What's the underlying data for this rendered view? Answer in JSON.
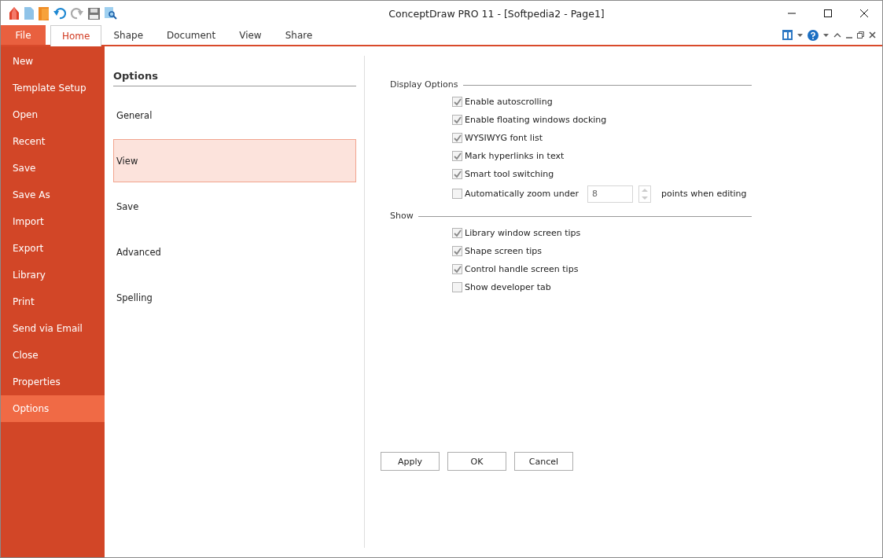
{
  "window": {
    "title": "ConceptDraw PRO 11 - [Softpedia2 - Page1]"
  },
  "ribbon_tabs": [
    {
      "label": "File",
      "kind": "file",
      "selected": false
    },
    {
      "label": "Home",
      "kind": "tab",
      "selected": true
    },
    {
      "label": "Shape",
      "kind": "tab",
      "selected": false
    },
    {
      "label": "Document",
      "kind": "tab",
      "selected": false
    },
    {
      "label": "View",
      "kind": "tab",
      "selected": false
    },
    {
      "label": "Share",
      "kind": "tab",
      "selected": false
    }
  ],
  "backstage_menu": [
    {
      "label": "New",
      "selected": false
    },
    {
      "label": "Template Setup",
      "selected": false
    },
    {
      "label": "Open",
      "selected": false
    },
    {
      "label": "Recent",
      "selected": false
    },
    {
      "label": "Save",
      "selected": false
    },
    {
      "label": "Save As",
      "selected": false
    },
    {
      "label": "Import",
      "selected": false
    },
    {
      "label": "Export",
      "selected": false
    },
    {
      "label": "Library",
      "selected": false
    },
    {
      "label": "Print",
      "selected": false
    },
    {
      "label": "Send via Email",
      "selected": false
    },
    {
      "label": "Close",
      "selected": false
    },
    {
      "label": "Properties",
      "selected": false
    },
    {
      "label": "Options",
      "selected": true
    }
  ],
  "options_pane": {
    "title": "Options",
    "categories": [
      {
        "label": "General",
        "selected": false
      },
      {
        "label": "View",
        "selected": true
      },
      {
        "label": "Save",
        "selected": false
      },
      {
        "label": "Advanced",
        "selected": false
      },
      {
        "label": "Spelling",
        "selected": false
      }
    ]
  },
  "groups": [
    {
      "title": "Display Options",
      "items": [
        {
          "kind": "checkbox",
          "label": "Enable autoscrolling",
          "checked": true
        },
        {
          "kind": "checkbox",
          "label": "Enable floating windows docking",
          "checked": true
        },
        {
          "kind": "checkbox",
          "label": "WYSIWYG font list",
          "checked": true
        },
        {
          "kind": "checkbox",
          "label": "Mark hyperlinks in text",
          "checked": true
        },
        {
          "kind": "checkbox",
          "label": "Smart tool switching",
          "checked": true
        },
        {
          "kind": "spin",
          "label": "Automatically zoom under",
          "checked": false,
          "value": "8",
          "suffix": "points when editing"
        }
      ]
    },
    {
      "title": "Show",
      "items": [
        {
          "kind": "checkbox",
          "label": "Library window screen tips",
          "checked": true
        },
        {
          "kind": "checkbox",
          "label": "Shape screen tips",
          "checked": true
        },
        {
          "kind": "checkbox",
          "label": "Control handle screen tips",
          "checked": true
        },
        {
          "kind": "checkbox",
          "label": "Show developer tab",
          "checked": false
        }
      ]
    }
  ],
  "buttons": [
    "Apply",
    "OK",
    "Cancel"
  ]
}
